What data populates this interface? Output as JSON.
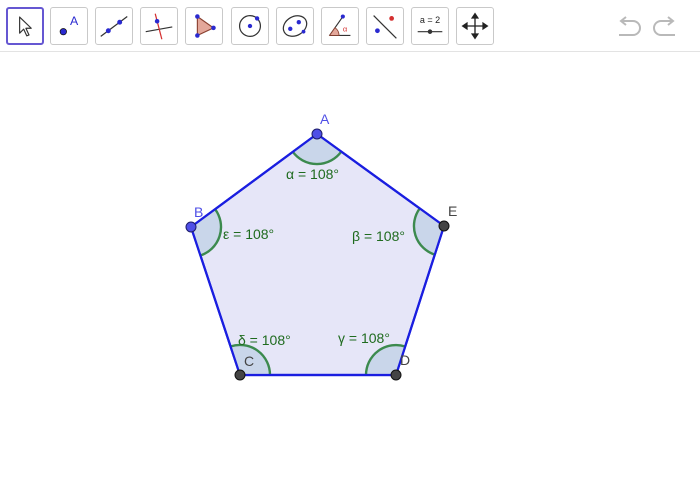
{
  "toolbar": {
    "tools": [
      {
        "name": "Move",
        "icon": "move-cursor-icon",
        "selected": true
      },
      {
        "name": "Point",
        "icon": "point-icon",
        "label": "A"
      },
      {
        "name": "Line",
        "icon": "line-icon"
      },
      {
        "name": "Perpendicular Line",
        "icon": "perpendicular-line-icon"
      },
      {
        "name": "Polygon",
        "icon": "polygon-icon"
      },
      {
        "name": "Circle with Center through Point",
        "icon": "circle-icon"
      },
      {
        "name": "Ellipse",
        "icon": "ellipse-icon"
      },
      {
        "name": "Angle",
        "icon": "angle-icon"
      },
      {
        "name": "Reflect about Line",
        "icon": "reflect-icon"
      },
      {
        "name": "Slider",
        "icon": "slider-icon",
        "label": "a = 2"
      },
      {
        "name": "Move Graphics View",
        "icon": "move-graphics-view-icon"
      }
    ],
    "undo_icon": "undo-icon",
    "redo_icon": "redo-icon"
  },
  "construction": {
    "points": {
      "A": {
        "label": "A",
        "color": "#4f4fe6"
      },
      "B": {
        "label": "B",
        "color": "#4f4fe6"
      },
      "C": {
        "label": "C",
        "color": "#444444"
      },
      "D": {
        "label": "D",
        "color": "#444444"
      },
      "E": {
        "label": "E",
        "color": "#444444"
      }
    },
    "angles": {
      "alpha": "α = 108°",
      "beta": "β = 108°",
      "gamma": "γ = 108°",
      "delta": "δ = 108°",
      "epsilon": "ε = 108°"
    },
    "colors": {
      "polygon_stroke": "#1a1ee0",
      "polygon_fill": "#e6e6f8",
      "angle_stroke": "#3c8a4e",
      "angle_fill": "#c9d6ea",
      "angle_text": "#1f6b1f",
      "accent": "#6557d2"
    }
  }
}
